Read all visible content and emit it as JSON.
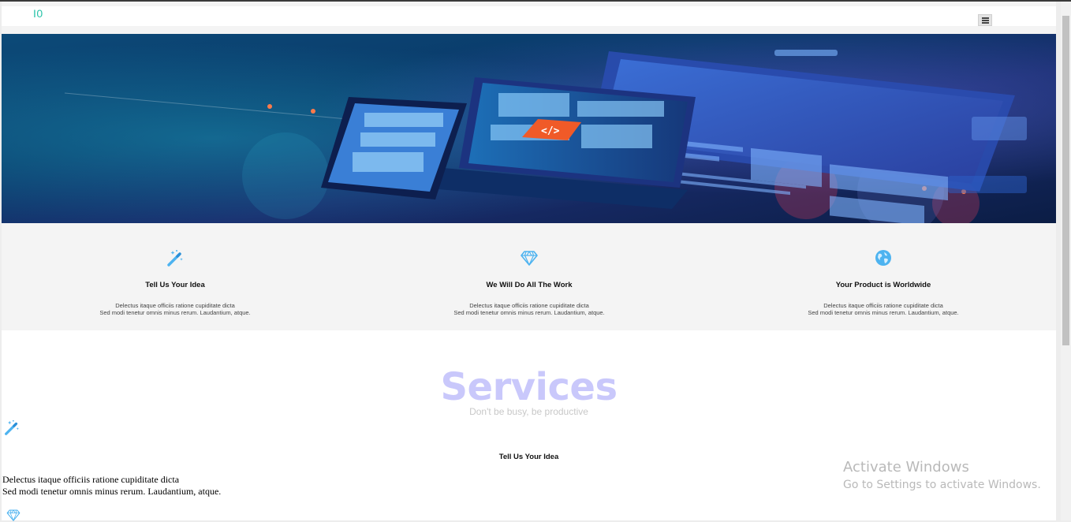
{
  "navbar": {
    "logo_text": "I0",
    "menu_icon": "hamburger-icon"
  },
  "hero": {
    "image": "hero-tech-devices-illustration",
    "badge_text": "</>"
  },
  "features": [
    {
      "icon": "magic-wand-icon",
      "title": "Tell Us Your Idea",
      "line1": "Delectus itaque officiis ratione cupiditate dicta",
      "line2": "Sed modi tenetur omnis minus rerum. Laudantium, atque."
    },
    {
      "icon": "diamond-icon",
      "title": "We Will Do All The Work",
      "line1": "Delectus itaque officiis ratione cupiditate dicta",
      "line2": "Sed modi tenetur omnis minus rerum. Laudantium, atque."
    },
    {
      "icon": "globe-icon",
      "title": "Your Product is Worldwide",
      "line1": "Delectus itaque officiis ratione cupiditate dicta",
      "line2": "Sed modi tenetur omnis minus rerum. Laudantium, atque."
    }
  ],
  "services": {
    "title": "Services",
    "subtitle": "Don't be busy, be productive",
    "first_item": {
      "icon": "magic-wand-icon",
      "title": "Tell Us Your Idea",
      "line1": "Delectus itaque officiis ratione cupiditate dicta",
      "line2": "Sed modi tenetur omnis minus rerum. Laudantium, atque."
    },
    "next_icon": "diamond-icon"
  },
  "watermark": {
    "line1": "Activate Windows",
    "line2": "Go to Settings to activate Windows."
  },
  "colors": {
    "icon_blue": "#4db3f0",
    "logo_teal": "#27c3a8",
    "services_title": "#c9c8fb",
    "hero_dark": "#0b2a4f"
  }
}
